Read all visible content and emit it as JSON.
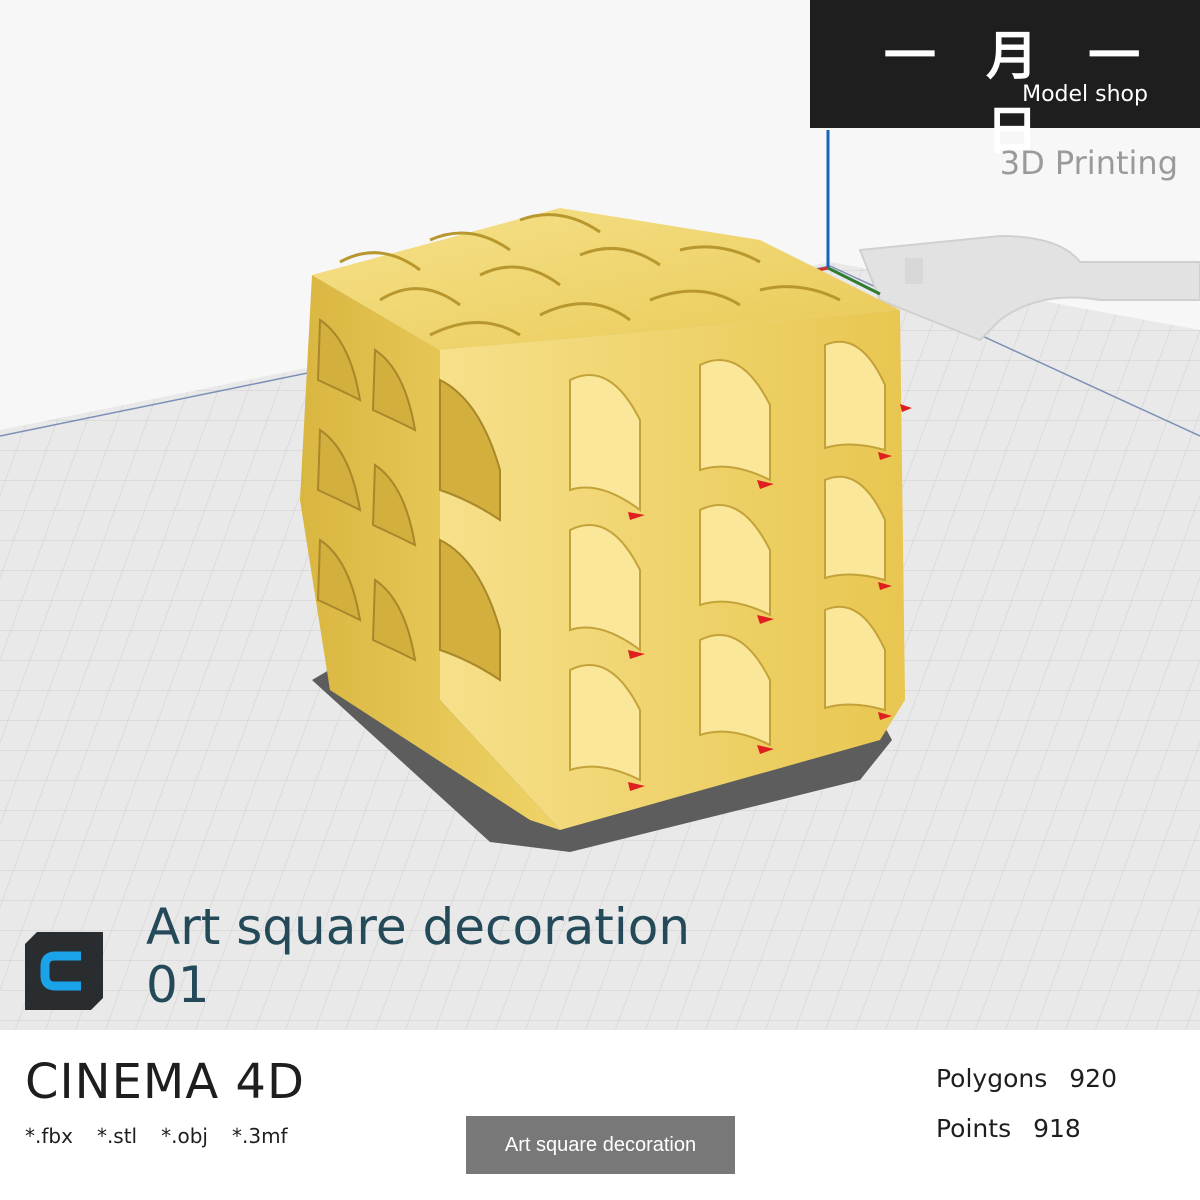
{
  "brand": {
    "title": "一 月 一 日",
    "subtitle": "Model shop",
    "tagline": "3D Printing"
  },
  "model": {
    "title_line1": "Art square decoration",
    "title_line2": "01"
  },
  "footer": {
    "software": "CINEMA 4D",
    "formats": [
      "*.fbx",
      "*.stl",
      "*.obj",
      "*.3mf"
    ],
    "name_button": "Art square decoration",
    "stats": [
      {
        "label": "Polygons",
        "value": "920"
      },
      {
        "label": "Points",
        "value": "918"
      }
    ]
  },
  "colors": {
    "model_yellow": "#f2d870",
    "model_shadow": "#c9a93a",
    "build_plate": "#e9e9e9",
    "grid_line": "#cfcfcf",
    "base_shadow": "#5c5c5c",
    "overhang_marker": "#e02020",
    "axis_x": "#d32f2f",
    "axis_y": "#2e7d32",
    "axis_z": "#1565c0",
    "title_teal": "#244a5a",
    "logo_blue": "#1aa3e8"
  },
  "icons": {
    "software_logo": "cinema4d-c-icon"
  }
}
